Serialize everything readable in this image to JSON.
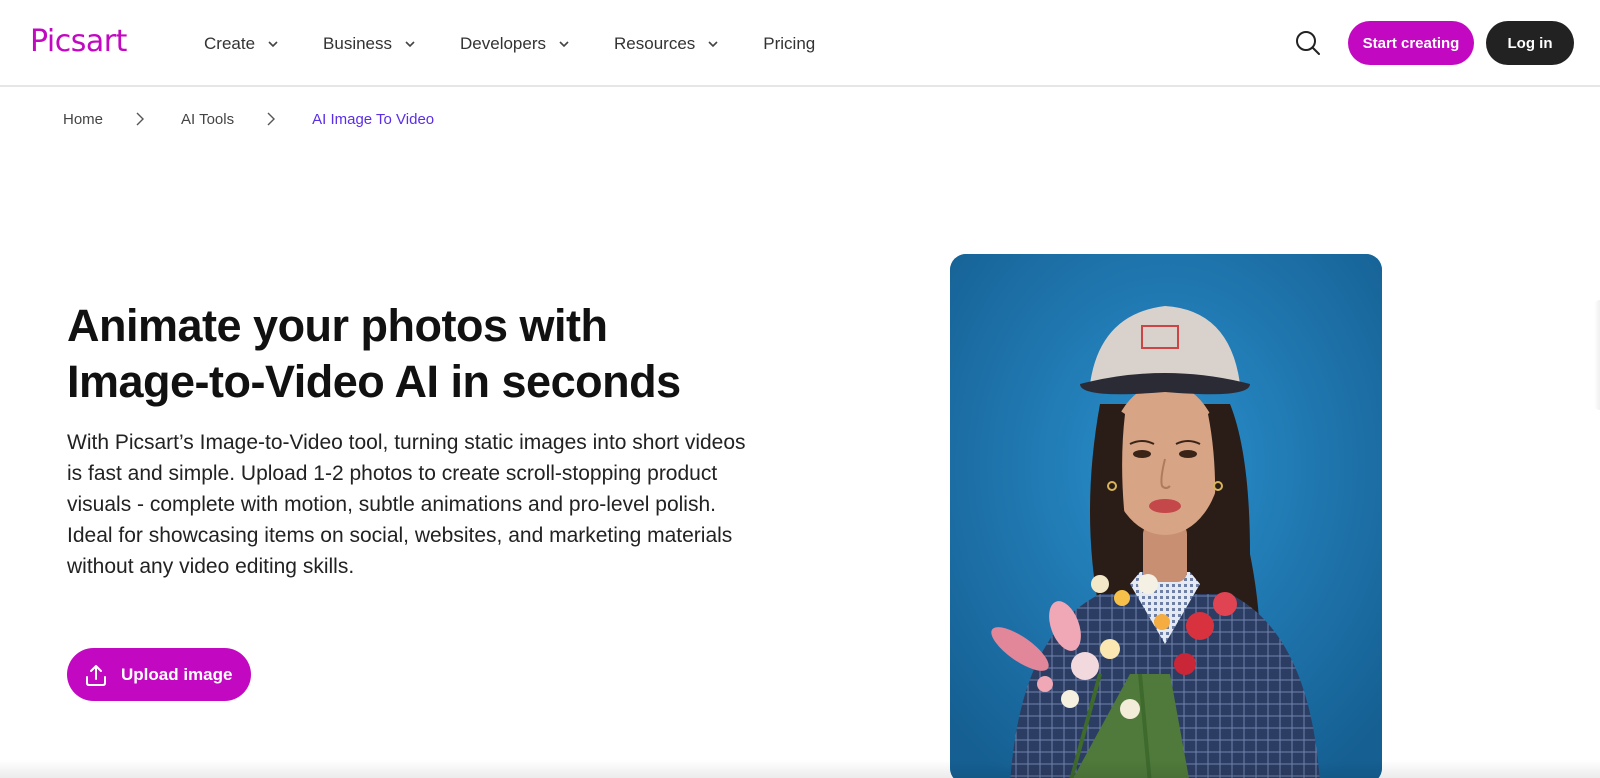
{
  "header": {
    "logo": "Picsart",
    "nav": [
      {
        "label": "Create",
        "has_dropdown": true
      },
      {
        "label": "Business",
        "has_dropdown": true
      },
      {
        "label": "Developers",
        "has_dropdown": true
      },
      {
        "label": "Resources",
        "has_dropdown": true
      },
      {
        "label": "Pricing",
        "has_dropdown": false
      }
    ],
    "search_icon": "search-icon",
    "start_label": "Start creating",
    "login_label": "Log in"
  },
  "breadcrumb": {
    "items": [
      "Home",
      "AI Tools",
      "AI Image To Video"
    ]
  },
  "hero": {
    "title_line1": "Animate your photos with",
    "title_line2": "Image-to-Video AI in seconds",
    "description": "With Picsart’s Image-to-Video tool, turning static images into short videos is fast and simple. Upload 1-2 photos to create scroll-stopping product visuals - complete with motion, subtle animations and pro-level polish. Ideal for showcasing items on social, websites, and marketing materials without any video editing skills.",
    "upload_label": "Upload image",
    "upload_icon": "upload-icon",
    "image_icon": "portrait-photo"
  },
  "colors": {
    "brand": "#c209c1",
    "breadcrumb_active": "#5a2ee6",
    "login_bg": "#222222",
    "image_bg": "#1d78b3"
  }
}
